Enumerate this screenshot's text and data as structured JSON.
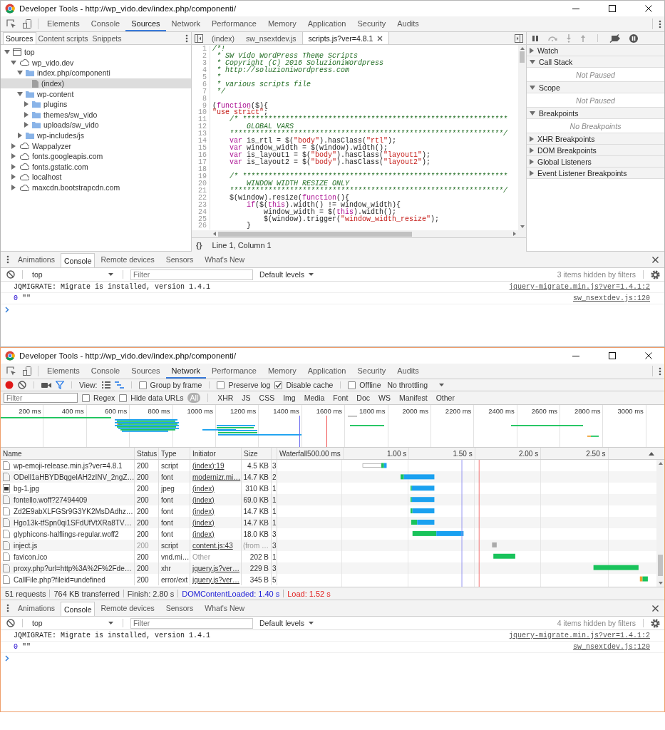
{
  "windows": [
    {
      "title": "Developer Tools - http://wp_vido.dev/index.php/componenti/",
      "main_tabs": [
        {
          "label": "Elements",
          "selected": false
        },
        {
          "label": "Console",
          "selected": false
        },
        {
          "label": "Sources",
          "selected": true
        },
        {
          "label": "Network",
          "selected": false
        },
        {
          "label": "Performance",
          "selected": false
        },
        {
          "label": "Memory",
          "selected": false
        },
        {
          "label": "Application",
          "selected": false
        },
        {
          "label": "Security",
          "selected": false
        },
        {
          "label": "Audits",
          "selected": false
        }
      ],
      "panel": {
        "kind": "sources",
        "navigator_tabs": [
          {
            "label": "Sources",
            "selected": true
          },
          {
            "label": "Content scripts",
            "selected": false
          },
          {
            "label": "Snippets",
            "selected": false
          }
        ],
        "file_tree": [
          {
            "label": "top",
            "kind": "frame",
            "expanded": true,
            "selected": false,
            "children": [
              {
                "label": "wp_vido.dev",
                "kind": "domain",
                "expanded": true,
                "selected": false,
                "children": [
                  {
                    "label": "index.php/componenti",
                    "kind": "folder",
                    "expanded": true,
                    "selected": false,
                    "children": [
                      {
                        "label": "(index)",
                        "kind": "file",
                        "selected": true
                      }
                    ]
                  },
                  {
                    "label": "wp-content",
                    "kind": "folder",
                    "expanded": true,
                    "selected": false,
                    "children": [
                      {
                        "label": "plugins",
                        "kind": "folder",
                        "expanded": false,
                        "selected": false
                      },
                      {
                        "label": "themes/sw_vido",
                        "kind": "folder",
                        "expanded": false,
                        "selected": false
                      },
                      {
                        "label": "uploads/sw_vido",
                        "kind": "folder",
                        "expanded": false,
                        "selected": false
                      }
                    ]
                  },
                  {
                    "label": "wp-includes/js",
                    "kind": "folder",
                    "expanded": false,
                    "selected": false
                  }
                ]
              },
              {
                "label": "Wappalyzer",
                "kind": "domain",
                "expanded": false,
                "selected": false
              },
              {
                "label": "fonts.googleapis.com",
                "kind": "domain",
                "expanded": false,
                "selected": false
              },
              {
                "label": "fonts.gstatic.com",
                "kind": "domain",
                "expanded": false,
                "selected": false
              },
              {
                "label": "localhost",
                "kind": "domain",
                "expanded": false,
                "selected": false
              },
              {
                "label": "maxcdn.bootstrapcdn.com",
                "kind": "domain",
                "expanded": false,
                "selected": false
              }
            ]
          }
        ],
        "editor_tabs": [
          {
            "label": "(index)",
            "selected": false,
            "closable": false
          },
          {
            "label": "sw_nsextdev.js",
            "selected": false,
            "closable": false
          },
          {
            "label": "scripts.js?ver=4.8.1",
            "selected": true,
            "closable": true
          }
        ],
        "code_lines": [
          {
            "number": "1",
            "segments": [
              {
                "kind": "comment",
                "text": "/*!"
              }
            ]
          },
          {
            "number": "2",
            "segments": [
              {
                "kind": "comment",
                "text": " * SW Vido WordPress Theme Scripts"
              }
            ]
          },
          {
            "number": "3",
            "segments": [
              {
                "kind": "comment",
                "text": " * Copyright (C) 2016 SoluzioniWordpress"
              }
            ]
          },
          {
            "number": "4",
            "segments": [
              {
                "kind": "comment",
                "text": " * http://soluzioniwordpress.com"
              }
            ]
          },
          {
            "number": "5",
            "segments": [
              {
                "kind": "comment",
                "text": " *"
              }
            ]
          },
          {
            "number": "6",
            "segments": [
              {
                "kind": "comment",
                "text": " * various scripts file"
              }
            ]
          },
          {
            "number": "7",
            "segments": [
              {
                "kind": "comment",
                "text": " */"
              }
            ]
          },
          {
            "number": "8"
          },
          {
            "number": "9",
            "segments": [
              {
                "kind": "plain",
                "text": "("
              },
              {
                "kind": "keyword",
                "text": "function"
              },
              {
                "kind": "plain",
                "text": "($){"
              }
            ]
          },
          {
            "number": "10",
            "segments": [
              {
                "kind": "string",
                "text": "\"use strict\""
              },
              {
                "kind": "plain",
                "text": ";"
              }
            ]
          },
          {
            "number": "11",
            "segments": [
              {
                "kind": "comment",
                "text": "    /* **************************************************************"
              }
            ]
          },
          {
            "number": "12",
            "segments": [
              {
                "kind": "comment",
                "text": "        GLOBAL VARS"
              }
            ]
          },
          {
            "number": "13",
            "segments": [
              {
                "kind": "comment",
                "text": "    ****************************************************************/"
              }
            ]
          },
          {
            "number": "14",
            "segments": [
              {
                "kind": "keyword",
                "text": "    var"
              },
              {
                "kind": "plain",
                "text": " is_rtl = $("
              },
              {
                "kind": "string",
                "text": "\"body\""
              },
              {
                "kind": "plain",
                "text": ").hasClass("
              },
              {
                "kind": "string",
                "text": "\"rtl\""
              },
              {
                "kind": "plain",
                "text": ");"
              }
            ]
          },
          {
            "number": "15",
            "segments": [
              {
                "kind": "keyword",
                "text": "    var"
              },
              {
                "kind": "plain",
                "text": " window_width = $(window).width();"
              }
            ]
          },
          {
            "number": "16",
            "segments": [
              {
                "kind": "keyword",
                "text": "    var"
              },
              {
                "kind": "plain",
                "text": " is_layout1 = $("
              },
              {
                "kind": "string",
                "text": "\"body\""
              },
              {
                "kind": "plain",
                "text": ").hasClass("
              },
              {
                "kind": "string",
                "text": "\"layout1\""
              },
              {
                "kind": "plain",
                "text": ");"
              }
            ]
          },
          {
            "number": "17",
            "segments": [
              {
                "kind": "keyword",
                "text": "    var"
              },
              {
                "kind": "plain",
                "text": " is_layout2 = $("
              },
              {
                "kind": "string",
                "text": "\"body\""
              },
              {
                "kind": "plain",
                "text": ").hasClass("
              },
              {
                "kind": "string",
                "text": "\"layout2\""
              },
              {
                "kind": "plain",
                "text": ");"
              }
            ]
          },
          {
            "number": "18"
          },
          {
            "number": "19",
            "segments": [
              {
                "kind": "comment",
                "text": "    /* **************************************************************"
              }
            ]
          },
          {
            "number": "20",
            "segments": [
              {
                "kind": "comment",
                "text": "        WINDOW WIDTH RESIZE ONLY"
              }
            ]
          },
          {
            "number": "21",
            "segments": [
              {
                "kind": "comment",
                "text": "    ****************************************************************/"
              }
            ]
          },
          {
            "number": "22",
            "segments": [
              {
                "kind": "plain",
                "text": "    $(window).resize("
              },
              {
                "kind": "keyword",
                "text": "function"
              },
              {
                "kind": "plain",
                "text": "(){"
              }
            ]
          },
          {
            "number": "23",
            "segments": [
              {
                "kind": "keyword",
                "text": "        if"
              },
              {
                "kind": "plain",
                "text": "($("
              },
              {
                "kind": "keyword",
                "text": "this"
              },
              {
                "kind": "plain",
                "text": ").width() != window_width){"
              }
            ]
          },
          {
            "number": "24",
            "segments": [
              {
                "kind": "plain",
                "text": "            window_width = $("
              },
              {
                "kind": "keyword",
                "text": "this"
              },
              {
                "kind": "plain",
                "text": ").width();"
              }
            ]
          },
          {
            "number": "25",
            "segments": [
              {
                "kind": "plain",
                "text": "            $(window).trigger("
              },
              {
                "kind": "string",
                "text": "\"window_width_resize\""
              },
              {
                "kind": "plain",
                "text": ");"
              }
            ]
          },
          {
            "number": "26",
            "segments": [
              {
                "kind": "plain",
                "text": "        }"
              }
            ]
          }
        ],
        "pretty_print": "{}",
        "cursor_position": "Line 1, Column 1",
        "debugger_sections": [
          {
            "label": "Watch",
            "expanded": false
          },
          {
            "label": "Call Stack",
            "expanded": true,
            "message": "Not Paused"
          },
          {
            "label": "Scope",
            "expanded": true,
            "message": "Not Paused"
          },
          {
            "label": "Breakpoints",
            "expanded": true,
            "message": "No Breakpoints"
          },
          {
            "label": "XHR Breakpoints",
            "expanded": false
          },
          {
            "label": "DOM Breakpoints",
            "expanded": false
          },
          {
            "label": "Global Listeners",
            "expanded": false
          },
          {
            "label": "Event Listener Breakpoints",
            "expanded": false
          }
        ]
      },
      "drawer": {
        "tabs": [
          {
            "label": "Animations",
            "selected": false
          },
          {
            "label": "Console",
            "selected": true
          },
          {
            "label": "Remote devices",
            "selected": false
          },
          {
            "label": "Sensors",
            "selected": false
          },
          {
            "label": "What's New",
            "selected": false
          }
        ],
        "context": "top",
        "filter_placeholder": "Filter",
        "levels": "Default levels",
        "hidden_note": "3 items hidden by filters",
        "messages": [
          {
            "text": "JQMIGRATE: Migrate is installed, version 1.4.1",
            "source": "jquery-migrate.min.js?ver=1.4.1:2"
          },
          {
            "number": "0",
            "text": "\"\"",
            "source": "sw_nsextdev.js:120"
          }
        ]
      }
    },
    {
      "title": "Developer Tools - http://wp_vido.dev/index.php/componenti/",
      "main_tabs": [
        {
          "label": "Elements",
          "selected": false
        },
        {
          "label": "Console",
          "selected": false
        },
        {
          "label": "Sources",
          "selected": false
        },
        {
          "label": "Network",
          "selected": true
        },
        {
          "label": "Performance",
          "selected": false
        },
        {
          "label": "Memory",
          "selected": false
        },
        {
          "label": "Application",
          "selected": false
        },
        {
          "label": "Security",
          "selected": false
        },
        {
          "label": "Audits",
          "selected": false
        }
      ],
      "panel": {
        "kind": "network",
        "recording": true,
        "filter_active": true,
        "view_label": "View:",
        "show_overview": true,
        "checkbox_groups": [
          [
            {
              "label": "Group by frame",
              "checked": false
            }
          ],
          [
            {
              "label": "Preserve log",
              "checked": false
            },
            {
              "label": "Disable cache",
              "checked": true
            }
          ],
          [
            {
              "label": "Offline",
              "checked": false
            }
          ]
        ],
        "throttling": "No throttling",
        "filter_placeholder": "Filter",
        "filter_options": [
          {
            "label": "Regex",
            "checked": false
          },
          {
            "label": "Hide data URLs",
            "checked": false
          }
        ],
        "type_filters": [
          {
            "label": "All",
            "selected": true
          },
          {
            "label": "XHR",
            "selected": false
          },
          {
            "label": "JS",
            "selected": false
          },
          {
            "label": "CSS",
            "selected": false
          },
          {
            "label": "Img",
            "selected": false
          },
          {
            "label": "Media",
            "selected": false
          },
          {
            "label": "Font",
            "selected": false
          },
          {
            "label": "Doc",
            "selected": false
          },
          {
            "label": "WS",
            "selected": false
          },
          {
            "label": "Manifest",
            "selected": false
          },
          {
            "label": "Other",
            "selected": false
          }
        ],
        "overview_ticks": [
          "200 ms",
          "400 ms",
          "600 ms",
          "800 ms",
          "1000 ms",
          "1200 ms",
          "1400 ms",
          "1600 ms",
          "1800 ms",
          "2000 ms",
          "2200 ms",
          "2400 ms",
          "2600 ms",
          "2800 ms",
          "3000 ms"
        ],
        "columns": [
          "Name",
          "Status",
          "Type",
          "Initiator",
          "Size"
        ],
        "waterfall_label": "Waterfall",
        "waterfall_ticks": [
          "500.00 ms",
          "1.00 s",
          "1.50 s",
          "2.00 s",
          "2.50 s"
        ],
        "rows": [
          {
            "name": "wp-emoji-release.min.js?ver=4.8.1",
            "kind": "document",
            "status": "200",
            "type": "script",
            "initiator": "(index):19",
            "initiator_link": true,
            "size": "4.5 KB",
            "column_6": "3",
            "cached": false
          },
          {
            "name": "ODell1aHBYDBqgeIAH2zINV_2ngZ…",
            "kind": "document",
            "status": "200",
            "type": "font",
            "initiator": "modernizr.mi…",
            "initiator_link": true,
            "size": "14.7 KB",
            "column_6": "2",
            "cached": false
          },
          {
            "name": "bg-1.jpg",
            "kind": "image",
            "status": "200",
            "type": "jpeg",
            "initiator": "(index)",
            "initiator_link": true,
            "size": "310 KB",
            "column_6": "1",
            "cached": false
          },
          {
            "name": "fontello.woff?27494409",
            "kind": "document",
            "status": "200",
            "type": "font",
            "initiator": "(index)",
            "initiator_link": true,
            "size": "69.0 KB",
            "column_6": "1",
            "cached": false
          },
          {
            "name": "Zd2E9abXLFGSr9G3YK2MsDAdhz…",
            "kind": "document",
            "status": "200",
            "type": "font",
            "initiator": "(index)",
            "initiator_link": true,
            "size": "14.7 KB",
            "column_6": "1",
            "cached": false
          },
          {
            "name": "Hgo13k-tfSpn0qi1SFdUfVtXRa8TV…",
            "kind": "document",
            "status": "200",
            "type": "font",
            "initiator": "(index)",
            "initiator_link": true,
            "size": "14.7 KB",
            "column_6": "1",
            "cached": false
          },
          {
            "name": "glyphicons-halflings-regular.woff2",
            "kind": "document",
            "status": "200",
            "type": "font",
            "initiator": "(index)",
            "initiator_link": true,
            "size": "18.0 KB",
            "column_6": "3",
            "cached": false
          },
          {
            "name": "inject.js",
            "kind": "document",
            "status": "200",
            "type": "script",
            "initiator": "content.js:43",
            "initiator_link": true,
            "size": "(from …",
            "column_6": "3",
            "cached": true
          },
          {
            "name": "favicon.ico",
            "kind": "document",
            "status": "200",
            "type": "vnd.mi…",
            "initiator": "Other",
            "initiator_link": false,
            "size": "202 B",
            "column_6": "1",
            "cached": false
          },
          {
            "name": "proxy.php?url=http%3A%2F%2Fde…",
            "kind": "document",
            "status": "200",
            "type": "xhr",
            "initiator": "jquery.js?ver…",
            "initiator_link": true,
            "size": "229 B",
            "column_6": "3",
            "cached": false
          },
          {
            "name": "CallFile.php?fileid=undefined",
            "kind": "document",
            "status": "200",
            "type": "error/ext",
            "initiator": "jquery.js?ver…",
            "initiator_link": true,
            "size": "345 B",
            "column_6": "5",
            "cached": false
          }
        ],
        "summary": [
          {
            "text": "51 requests",
            "color": "#333333"
          },
          {
            "text": "764 KB transferred",
            "color": "#333333"
          },
          {
            "text": "Finish: 2.80 s",
            "color": "#333333"
          },
          {
            "text": "DOMContentLoaded: 1.40 s",
            "color": "#1a1ad6"
          },
          {
            "text": "Load: 1.52 s",
            "color": "#e01b1b"
          }
        ]
      },
      "drawer": {
        "tabs": [
          {
            "label": "Animations",
            "selected": false
          },
          {
            "label": "Console",
            "selected": true
          },
          {
            "label": "Remote devices",
            "selected": false
          },
          {
            "label": "Sensors",
            "selected": false
          },
          {
            "label": "What's New",
            "selected": false
          }
        ],
        "context": "top",
        "filter_placeholder": "Filter",
        "levels": "Default levels",
        "hidden_note": "4 items hidden by filters",
        "messages": [
          {
            "text": "JQMIGRATE: Migrate is installed, version 1.4.1",
            "source": "jquery-migrate.min.js?ver=1.4.1:2"
          },
          {
            "number": "0",
            "text": "\"\"",
            "source": "sw_nsextdev.js:120"
          }
        ]
      }
    }
  ]
}
